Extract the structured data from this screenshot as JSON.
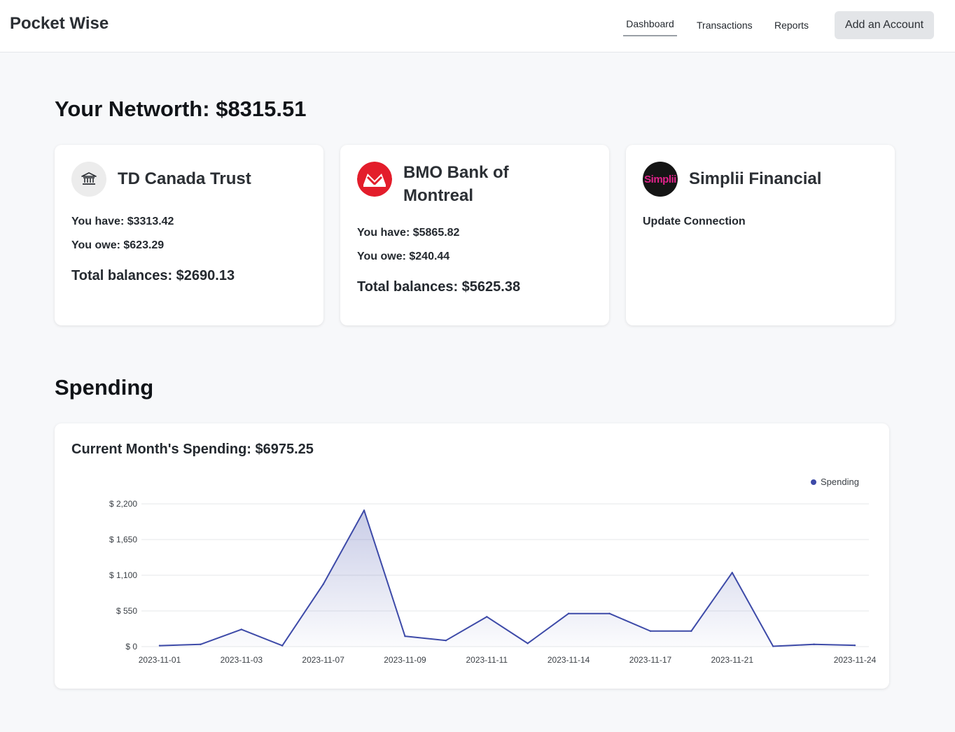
{
  "header": {
    "brand": "Pocket Wise",
    "nav": {
      "dashboard": "Dashboard",
      "transactions": "Transactions",
      "reports": "Reports"
    },
    "add_account": "Add an Account"
  },
  "networth": {
    "label": "Your Networth:",
    "value": "$8315.51"
  },
  "accounts": [
    {
      "name": "TD Canada Trust",
      "icon": "bank-icon",
      "have": "You have: $3313.42",
      "owe": "You owe: $623.29",
      "total": "Total balances: $2690.13"
    },
    {
      "name": "BMO Bank of Montreal",
      "icon": "bmo-logo",
      "have": "You have: $5865.82",
      "owe": "You owe: $240.44",
      "total": "Total balances: $5625.38"
    },
    {
      "name": "Simplii Financial",
      "logo_text": "Simplii",
      "status": "Update Connection"
    }
  ],
  "spending": {
    "heading": "Spending",
    "current_month": "Current Month's Spending: $6975.25"
  },
  "colors": {
    "line": "#3d4aa8",
    "accent_red": "#e31d2b",
    "simplii_pink": "#e0228a"
  },
  "chart_data": {
    "type": "area",
    "legend": [
      "Spending"
    ],
    "legend_position": "top-right",
    "ylim": [
      0,
      2200
    ],
    "yticks": [
      "$ 0",
      "$ 550",
      "$ 1,100",
      "$ 1,650",
      "$ 2,200"
    ],
    "ytick_values": [
      0,
      550,
      1100,
      1650,
      2200
    ],
    "xtick_labels": [
      "2023-11-01",
      "2023-11-03",
      "2023-11-07",
      "2023-11-09",
      "2023-11-11",
      "2023-11-14",
      "2023-11-17",
      "2023-11-21",
      "2023-11-24"
    ],
    "xtick_indices": [
      0,
      2,
      4,
      6,
      8,
      10,
      12,
      14,
      17
    ],
    "series": [
      {
        "name": "Spending",
        "values": [
          15,
          35,
          265,
          15,
          960,
          2100,
          160,
          95,
          460,
          50,
          510,
          510,
          240,
          240,
          1140,
          5,
          35,
          20
        ]
      }
    ],
    "grid": true
  }
}
